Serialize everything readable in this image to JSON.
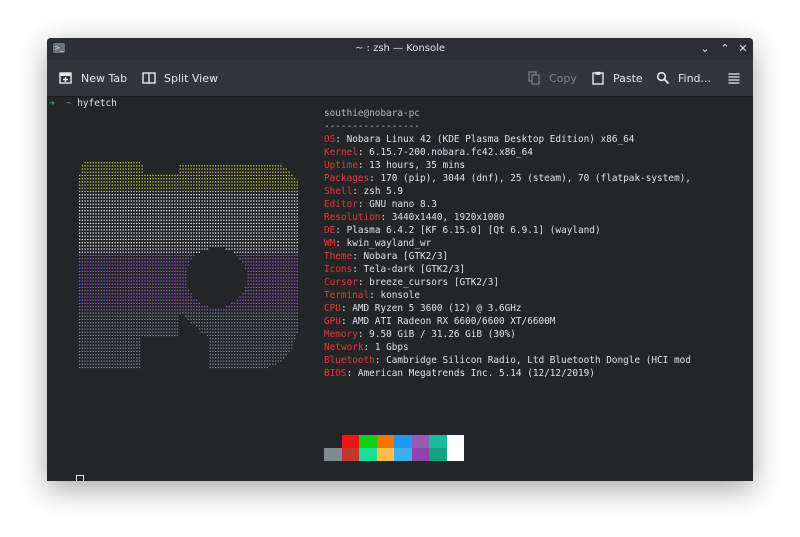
{
  "window": {
    "title": "~ : zsh — Konsole"
  },
  "toolbar": {
    "new_tab": "New Tab",
    "split_view": "Split View",
    "copy": "Copy",
    "paste": "Paste",
    "find": "Find...",
    "menu_icon": "hamburger-icon"
  },
  "terminal": {
    "prompt_arrow": "➜",
    "prompt_dir": "~",
    "command": "hyfetch",
    "userhost": "southie@nobara-pc",
    "separator": "-----------------",
    "info": [
      {
        "key": "OS",
        "value": "Nobara Linux 42 (KDE Plasma Desktop Edition) x86_64"
      },
      {
        "key": "Kernel",
        "value": "6.15.7-200.nobara.fc42.x86_64"
      },
      {
        "key": "Uptime",
        "value": "13 hours, 35 mins"
      },
      {
        "key": "Packages",
        "value": "170 (pip), 3044 (dnf), 25 (steam), 70 (flatpak-system),"
      },
      {
        "key": "Shell",
        "value": "zsh 5.9"
      },
      {
        "key": "Editor",
        "value": "GNU nano 8.3"
      },
      {
        "key": "Resolution",
        "value": "3440x1440, 1920x1080"
      },
      {
        "key": "DE",
        "value": "Plasma 6.4.2 [KF 6.15.0] [Qt 6.9.1] (wayland)"
      },
      {
        "key": "WM",
        "value": "kwin_wayland_wr"
      },
      {
        "key": "Theme",
        "value": "Nobara [GTK2/3]"
      },
      {
        "key": "Icons",
        "value": "Tela-dark [GTK2/3]"
      },
      {
        "key": "Cursor",
        "value": "breeze_cursors [GTK2/3]"
      },
      {
        "key": "Terminal",
        "value": "konsole"
      },
      {
        "key": "CPU",
        "value": "AMD Ryzen 5 3600 (12) @ 3.6GHz"
      },
      {
        "key": "GPU",
        "value": "AMD ATI Radeon RX 6600/6600 XT/6600M"
      },
      {
        "key": "Memory",
        "value": "9.50 GiB / 31.26 GiB (30%)"
      },
      {
        "key": "Network",
        "value": "1 Gbps"
      },
      {
        "key": "Bluetooth",
        "value": "Cambridge Silicon Radio, Ltd Bluetooth Dongle (HCI mod"
      },
      {
        "key": "BIOS",
        "value": "American Megatrends Inc. 5.14 (12/12/2019)"
      }
    ],
    "palette_top": [
      "#232629",
      "#ed1515",
      "#11d116",
      "#f67400",
      "#1d99f3",
      "#9b59b6",
      "#1abc9c",
      "#fcfcfc"
    ],
    "palette_bottom": [
      "#7f8c8d",
      "#c0392b",
      "#1cdc9a",
      "#fdbc4b",
      "#3daee9",
      "#8e44ad",
      "#16a085",
      "#ffffff"
    ],
    "logo_colors": [
      "#c9c24f",
      "#e3e3e3",
      "#9b59b6",
      "#7f8c8d"
    ]
  }
}
